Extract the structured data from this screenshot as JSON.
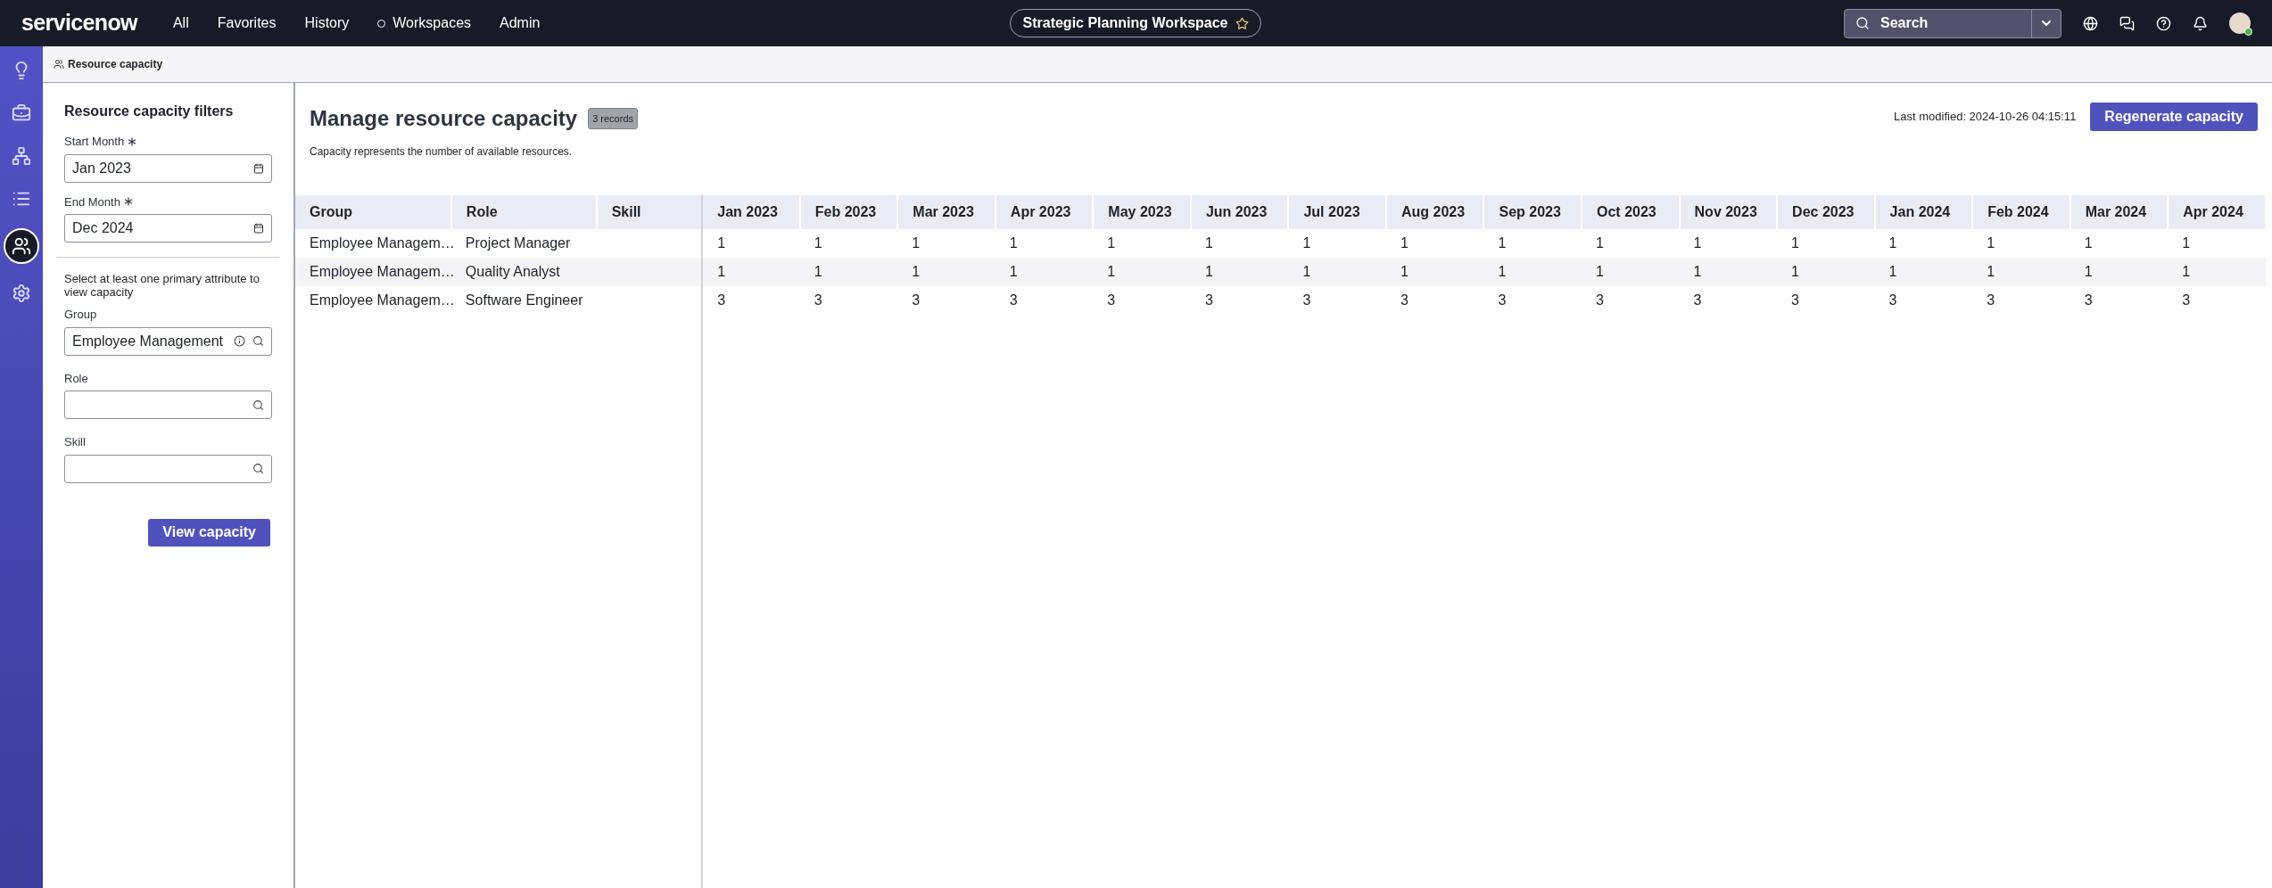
{
  "top_nav": {
    "logo": "servicenow",
    "menu": [
      {
        "label": "All",
        "kind": "text"
      },
      {
        "label": "Favorites",
        "kind": "text"
      },
      {
        "label": "History",
        "kind": "text"
      },
      {
        "label": "Workspaces",
        "kind": "circle"
      },
      {
        "label": "Admin",
        "kind": "text"
      }
    ],
    "workspace": "Strategic Planning Workspace",
    "search": {
      "placeholder": "Search"
    }
  },
  "rail": [
    {
      "kind": "lightbulb",
      "selected": false
    },
    {
      "kind": "briefcase",
      "selected": false
    },
    {
      "kind": "tree",
      "selected": false
    },
    {
      "kind": "list",
      "selected": false
    },
    {
      "kind": "people",
      "selected": true
    },
    {
      "kind": "gear",
      "selected": false
    }
  ],
  "breadcrumb": "Resource capacity",
  "filters": {
    "title": "Resource capacity filters",
    "start_month": {
      "label": "Start Month",
      "required": true,
      "value": "Jan 2023"
    },
    "end_month": {
      "label": "End Month",
      "required": true,
      "value": "Dec 2024"
    },
    "hint": "Select at least one primary attribute to view capacity",
    "group": {
      "label": "Group",
      "value": "Employee Management"
    },
    "role": {
      "label": "Role"
    },
    "skill": {
      "label": "Skill"
    },
    "button": "View capacity"
  },
  "main": {
    "title": "Manage resource capacity",
    "badge": "3 records",
    "subtitle": "Capacity represents the number of available resources.",
    "last_modified": "Last modified: 2024-10-26 04:15:11",
    "button": "Regenerate capacity"
  },
  "table": {
    "columns": [
      "Group",
      "Role",
      "Skill"
    ],
    "months": [
      "Jan 2023",
      "Feb 2023",
      "Mar 2023",
      "Apr 2023",
      "May 2023",
      "Jun 2023",
      "Jul 2023",
      "Aug 2023",
      "Sep 2023",
      "Oct 2023",
      "Nov 2023",
      "Dec 2023",
      "Jan 2024",
      "Feb 2024",
      "Mar 2024",
      "Apr 2024"
    ],
    "rows": [
      {
        "group": "Employee Managem…",
        "role": "Project Manager",
        "values": [
          "1",
          "1",
          "1",
          "1",
          "1",
          "1",
          "1",
          "1",
          "1",
          "1",
          "1",
          "1",
          "1",
          "1",
          "1",
          "1"
        ]
      },
      {
        "group": "Employee Managem…",
        "role": "Quality Analyst",
        "values": [
          "1",
          "1",
          "1",
          "1",
          "1",
          "1",
          "1",
          "1",
          "1",
          "1",
          "1",
          "1",
          "1",
          "1",
          "1",
          "1"
        ]
      },
      {
        "group": "Employee Managem…",
        "role": "Software Engineer",
        "values": [
          "3",
          "3",
          "3",
          "3",
          "3",
          "3",
          "3",
          "3",
          "3",
          "3",
          "3",
          "3",
          "3",
          "3",
          "3",
          "3"
        ]
      }
    ]
  }
}
